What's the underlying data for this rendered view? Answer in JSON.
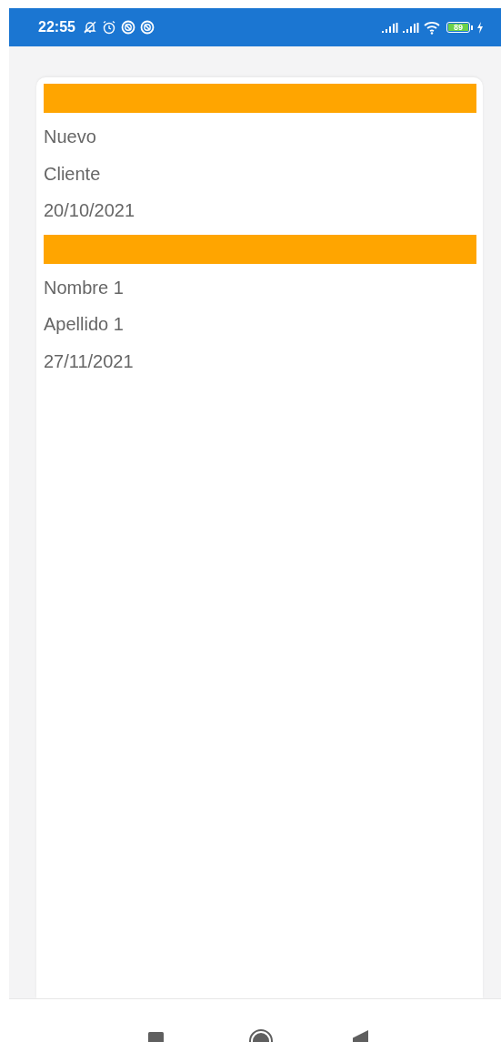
{
  "status_bar": {
    "time": "22:55",
    "battery": "89"
  },
  "clients": [
    {
      "name": "Nuevo",
      "surname": "Cliente",
      "date": "20/10/2021"
    },
    {
      "name": "Nombre 1",
      "surname": "Apellido 1",
      "date": "27/11/2021"
    }
  ]
}
